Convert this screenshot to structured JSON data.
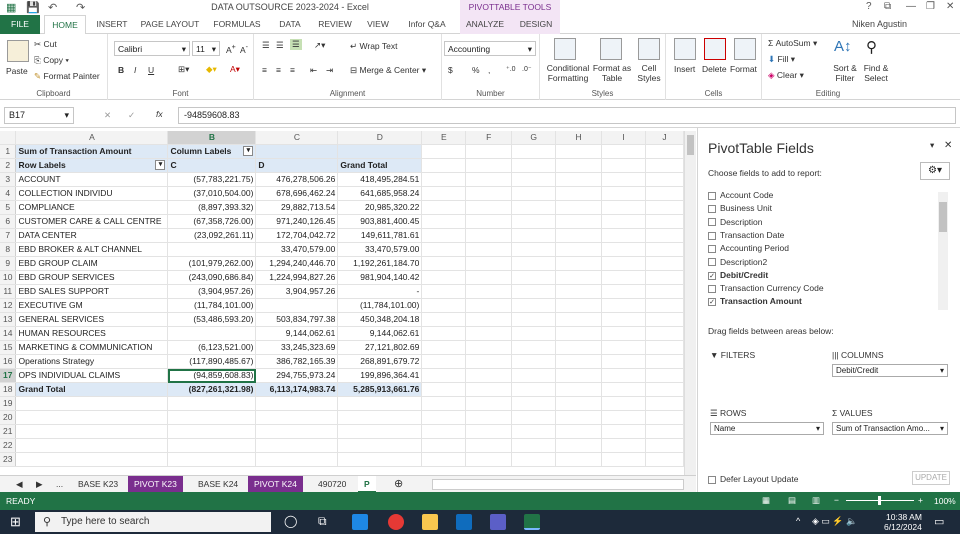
{
  "window": {
    "title": "DATA OUTSOURCE 2023-2024 - Excel",
    "context_tab_group": "PIVOTTABLE TOOLS",
    "user": "Niken Agustin"
  },
  "ribbon_tabs": [
    "FILE",
    "HOME",
    "INSERT",
    "PAGE LAYOUT",
    "FORMULAS",
    "DATA",
    "REVIEW",
    "VIEW",
    "Infor Q&A",
    "ANALYZE",
    "DESIGN"
  ],
  "ribbon": {
    "clipboard": {
      "paste": "Paste",
      "cut": "Cut",
      "copy": "Copy",
      "format_painter": "Format Painter",
      "label": "Clipboard"
    },
    "font": {
      "name": "Calibri",
      "size": "11",
      "bold": "B",
      "italic": "I",
      "underline": "U",
      "label": "Font"
    },
    "alignment": {
      "wrap": "Wrap Text",
      "merge": "Merge & Center",
      "label": "Alignment"
    },
    "number": {
      "format": "Accounting",
      "currency": "$",
      "percent": "%",
      "comma": ",",
      "label": "Number"
    },
    "styles": {
      "conditional": "Conditional Formatting",
      "format_table": "Format as Table",
      "cell_styles": "Cell Styles",
      "label": "Styles"
    },
    "cells": {
      "insert": "Insert",
      "delete": "Delete",
      "format": "Format",
      "label": "Cells"
    },
    "editing": {
      "autosum": "AutoSum",
      "fill": "Fill",
      "clear": "Clear",
      "sort": "Sort & Filter",
      "find": "Find & Select",
      "label": "Editing"
    }
  },
  "formula_bar": {
    "name_box": "B17",
    "fx": "fx",
    "value": "-94859608.83"
  },
  "columns": [
    "A",
    "B",
    "C",
    "D",
    "E",
    "F",
    "G",
    "H",
    "I",
    "J"
  ],
  "sheet": {
    "row1": {
      "a": "Sum of Transaction Amount",
      "b": "Column Labels"
    },
    "row2": {
      "a": "Row Labels",
      "b": "C",
      "c": "D",
      "d": "Grand Total"
    },
    "rows": [
      {
        "r": "3",
        "a": "ACCOUNT",
        "b": "(57,783,221.75)",
        "c": "476,278,506.26",
        "d": "418,495,284.51"
      },
      {
        "r": "4",
        "a": "COLLECTION INDIVIDU",
        "b": "(37,010,504.00)",
        "c": "678,696,462.24",
        "d": "641,685,958.24"
      },
      {
        "r": "5",
        "a": "COMPLIANCE",
        "b": "(8,897,393.32)",
        "c": "29,882,713.54",
        "d": "20,985,320.22"
      },
      {
        "r": "6",
        "a": "CUSTOMER CARE & CALL CENTRE",
        "b": "(67,358,726.00)",
        "c": "971,240,126.45",
        "d": "903,881,400.45"
      },
      {
        "r": "7",
        "a": "DATA CENTER",
        "b": "(23,092,261.11)",
        "c": "172,704,042.72",
        "d": "149,611,781.61"
      },
      {
        "r": "8",
        "a": "EBD BROKER & ALT CHANNEL",
        "b": "",
        "c": "33,470,579.00",
        "d": "33,470,579.00"
      },
      {
        "r": "9",
        "a": "EBD GROUP CLAIM",
        "b": "(101,979,262.00)",
        "c": "1,294,240,446.70",
        "d": "1,192,261,184.70"
      },
      {
        "r": "10",
        "a": "EBD GROUP SERVICES",
        "b": "(243,090,686.84)",
        "c": "1,224,994,827.26",
        "d": "981,904,140.42"
      },
      {
        "r": "11",
        "a": "EBD SALES SUPPORT",
        "b": "(3,904,957.26)",
        "c": "3,904,957.26",
        "d": "-"
      },
      {
        "r": "12",
        "a": "EXECUTIVE GM",
        "b": "(11,784,101.00)",
        "c": "",
        "d": "(11,784,101.00)"
      },
      {
        "r": "13",
        "a": "GENERAL SERVICES",
        "b": "(53,486,593.20)",
        "c": "503,834,797.38",
        "d": "450,348,204.18"
      },
      {
        "r": "14",
        "a": "HUMAN RESOURCES",
        "b": "",
        "c": "9,144,062.61",
        "d": "9,144,062.61"
      },
      {
        "r": "15",
        "a": "MARKETING & COMMUNICATION",
        "b": "(6,123,521.00)",
        "c": "33,245,323.69",
        "d": "27,121,802.69"
      },
      {
        "r": "16",
        "a": "Operations Strategy",
        "b": "(117,890,485.67)",
        "c": "386,782,165.39",
        "d": "268,891,679.72"
      },
      {
        "r": "17",
        "a": "OPS INDIVIDUAL CLAIMS",
        "b": "(94,859,608.83)",
        "c": "294,755,973.24",
        "d": "199,896,364.41"
      }
    ],
    "total": {
      "r": "18",
      "a": "Grand Total",
      "b": "(827,261,321.98)",
      "c": "6,113,174,983.74",
      "d": "5,285,913,661.76"
    },
    "empty_rows": [
      "19",
      "20",
      "21",
      "22",
      "23"
    ]
  },
  "sheet_tabs": [
    "...",
    "BASE K23",
    "PIVOT K23",
    "BASE K24",
    "PIVOT K24",
    "490720",
    "P"
  ],
  "pivot_pane": {
    "title": "PivotTable Fields",
    "subtitle": "Choose fields to add to report:",
    "fields": [
      {
        "name": "Account Code",
        "checked": false
      },
      {
        "name": "Business Unit",
        "checked": false
      },
      {
        "name": "Description",
        "checked": false
      },
      {
        "name": "Transaction Date",
        "checked": false
      },
      {
        "name": "Accounting Period",
        "checked": false
      },
      {
        "name": "Description2",
        "checked": false
      },
      {
        "name": "Debit/Credit",
        "checked": true
      },
      {
        "name": "Transaction Currency Code",
        "checked": false
      },
      {
        "name": "Transaction Amount",
        "checked": true
      }
    ],
    "drag_hint": "Drag fields between areas below:",
    "filters": "FILTERS",
    "columns": "COLUMNS",
    "columns_value": "Debit/Credit",
    "rows": "ROWS",
    "rows_value": "Name",
    "values": "VALUES",
    "values_value": "Sum of Transaction Amo...",
    "defer": "Defer Layout Update",
    "update": "UPDATE"
  },
  "status": {
    "ready": "READY",
    "zoom": "100%"
  },
  "taskbar": {
    "search_placeholder": "Type here to search",
    "time": "10:38 AM",
    "date": "6/12/2024"
  }
}
